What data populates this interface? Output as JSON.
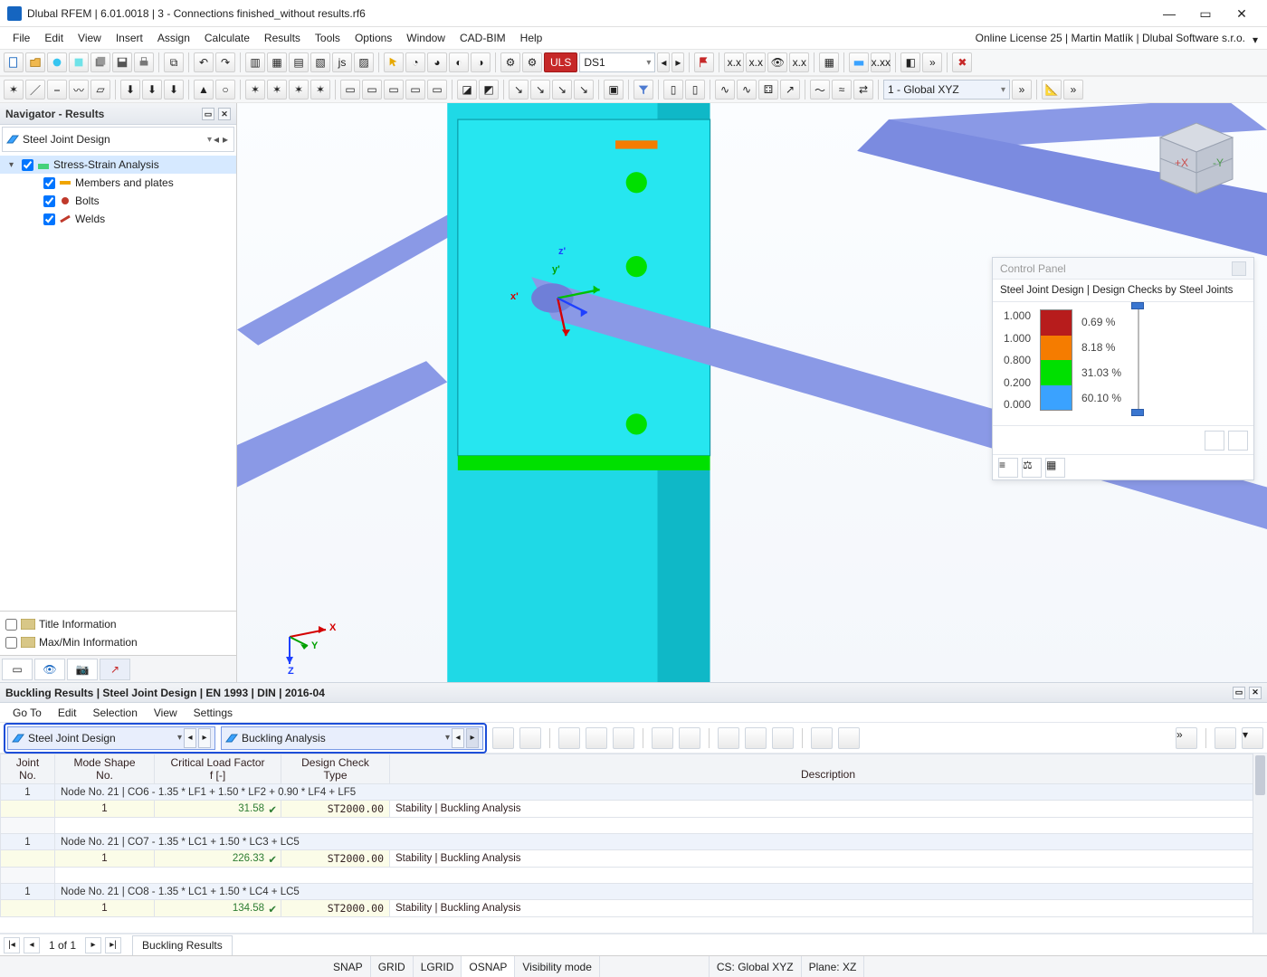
{
  "titlebar": {
    "title": "Dlubal RFEM | 6.01.0018 | 3 - Connections finished_without results.rf6"
  },
  "menubar": {
    "items": [
      "File",
      "Edit",
      "View",
      "Insert",
      "Assign",
      "Calculate",
      "Results",
      "Tools",
      "Options",
      "Window",
      "CAD-BIM",
      "Help"
    ],
    "license": "Online License 25 | Martin Matlík | Dlubal Software s.r.o."
  },
  "toolbar1": {
    "uls_badge": "ULS",
    "ds_combo": "DS1",
    "cs_combo": "1 - Global XYZ"
  },
  "navigator": {
    "title": "Navigator - Results",
    "picker": "Steel Joint Design",
    "tree": {
      "root": "Stress-Strain Analysis",
      "children": [
        "Members and plates",
        "Bolts",
        "Welds"
      ]
    },
    "bottom": [
      "Title Information",
      "Max/Min Information"
    ]
  },
  "axes": {
    "x": "X",
    "y": "Y",
    "z": "Z",
    "xp": "x'",
    "yp": "y'",
    "zp": "z'"
  },
  "control_panel": {
    "title": "Control Panel",
    "subtitle": "Steel Joint Design | Design Checks by Steel Joints",
    "ticks": [
      "1.000",
      "1.000",
      "0.800",
      "0.200",
      "0.000"
    ],
    "rows": [
      {
        "color": "#b71c1c",
        "pct": "0.69 %"
      },
      {
        "color": "#f57c00",
        "pct": "8.18 %"
      },
      {
        "color": "#00e000",
        "pct": "31.03 %"
      },
      {
        "color": "#3aa2ff",
        "pct": "60.10 %"
      }
    ]
  },
  "results": {
    "title": "Buckling Results | Steel Joint Design | EN 1993 | DIN | 2016-04",
    "menus": [
      "Go To",
      "Edit",
      "Selection",
      "View",
      "Settings"
    ],
    "picker1": "Steel Joint Design",
    "picker2": "Buckling Analysis",
    "columns": {
      "c1a": "Joint",
      "c1b": "No.",
      "c2a": "Mode Shape",
      "c2b": "No.",
      "c3a": "Critical Load Factor",
      "c3b": "f [-]",
      "c4a": "Design Check",
      "c4b": "Type",
      "c5": "Description"
    },
    "rows": [
      {
        "kind": "group",
        "joint": "1",
        "label": "Node No. 21 | CO6 - 1.35 * LF1 + 1.50 * LF2 + 0.90 * LF4 + LF5"
      },
      {
        "kind": "data",
        "mode": "1",
        "f": "31.58",
        "type": "ST2000.00",
        "desc": "Stability | Buckling Analysis"
      },
      {
        "kind": "spacer"
      },
      {
        "kind": "group",
        "joint": "1",
        "label": "Node No. 21 | CO7 - 1.35 * LC1 + 1.50 * LC3 + LC5"
      },
      {
        "kind": "data",
        "mode": "1",
        "f": "226.33",
        "type": "ST2000.00",
        "desc": "Stability | Buckling Analysis"
      },
      {
        "kind": "spacer"
      },
      {
        "kind": "group",
        "joint": "1",
        "label": "Node No. 21 | CO8 - 1.35 * LC1 + 1.50 * LC4 + LC5"
      },
      {
        "kind": "data",
        "mode": "1",
        "f": "134.58",
        "type": "ST2000.00",
        "desc": "Stability | Buckling Analysis"
      }
    ],
    "pager": {
      "text": "1 of 1",
      "tab": "Buckling Results"
    }
  },
  "status": {
    "snap": "SNAP",
    "grid": "GRID",
    "lgrid": "LGRID",
    "osnap": "OSNAP",
    "vis": "Visibility mode",
    "cs": "CS: Global XYZ",
    "plane": "Plane: XZ"
  }
}
